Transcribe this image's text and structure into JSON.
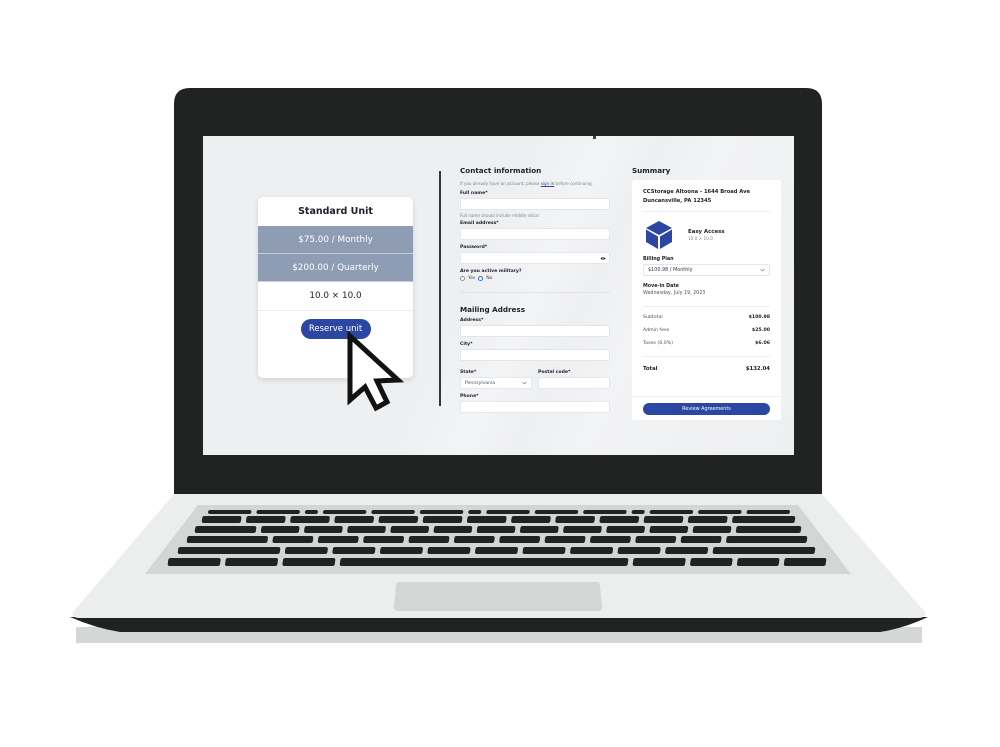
{
  "unit_card": {
    "title": "Standard Unit",
    "prices": [
      "$75.00 / Monthly",
      "$200.00 / Quarterly"
    ],
    "size": "10.0 × 10.0",
    "reserve_label": "Reserve unit"
  },
  "contact": {
    "heading": "Contact information",
    "signin_prefix": "If you already have an account, please ",
    "signin_link": "sign in",
    "signin_suffix": " before continuing.",
    "full_name_label": "Full name*",
    "full_name_value": "",
    "full_name_hint": "Full name should include middle initial",
    "email_label": "Email address*",
    "email_value": "",
    "password_label": "Password*",
    "password_value": "",
    "military_label": "Are you active military?",
    "military_options": [
      "Yes",
      "No"
    ],
    "military_selected": "No"
  },
  "mailing": {
    "heading": "Mailing Address",
    "address_label": "Address*",
    "address_value": "",
    "city_label": "City*",
    "city_value": "",
    "state_label": "State*",
    "state_value": "Pennsylvania",
    "postal_label": "Postal code*",
    "postal_value": "",
    "phone_label": "Phone*",
    "phone_value": ""
  },
  "summary": {
    "heading": "Summary",
    "address_line1": "CCStorage Altoona - 1644 Broad Ave",
    "address_line2": "Duncansville, PA 12345",
    "product_name": "Easy Access",
    "product_size": "10.0 × 10.0",
    "billing_label": "Billing Plan",
    "billing_value": "$100.98 / Monthly",
    "movein_label": "Move-in Date",
    "movein_value": "Wednesday, July 19, 2023",
    "lines": [
      {
        "label": "Subtotal",
        "value": "$100.98"
      },
      {
        "label": "Admin fees",
        "value": "$25.00"
      },
      {
        "label": "Taxes (6.0%)",
        "value": "$6.06"
      }
    ],
    "total_label": "Total",
    "total_value": "$132.04",
    "review_label": "Review Agreements"
  },
  "colors": {
    "accent": "#2b47a3",
    "price_band": "#8e9db4",
    "bezel": "#202322",
    "chassis": "#eceeed",
    "keyboard_well": "#d2d7d5"
  },
  "icons": {
    "eye": "eye-icon",
    "chevron": "chevron-down-icon",
    "cube": "cube-icon",
    "cursor": "mouse-pointer-icon"
  }
}
